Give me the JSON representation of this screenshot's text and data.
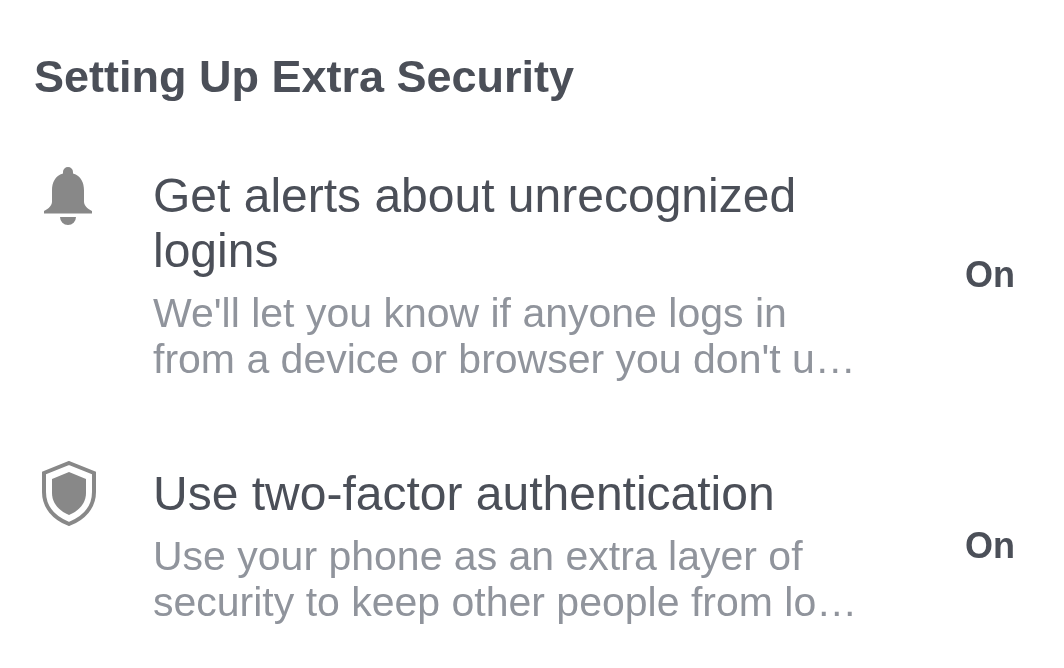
{
  "heading": "Setting Up Extra Security",
  "settings": [
    {
      "kind": "alerts",
      "title": "Get alerts about unrecognized logins",
      "description": "We'll let you know if anyone logs in from a device or browser you don't u…",
      "status": "On"
    },
    {
      "kind": "authentication",
      "title": "Use two-factor authentication",
      "description": "Use your phone as an extra layer of security to keep other people from lo…",
      "status": "On"
    }
  ]
}
